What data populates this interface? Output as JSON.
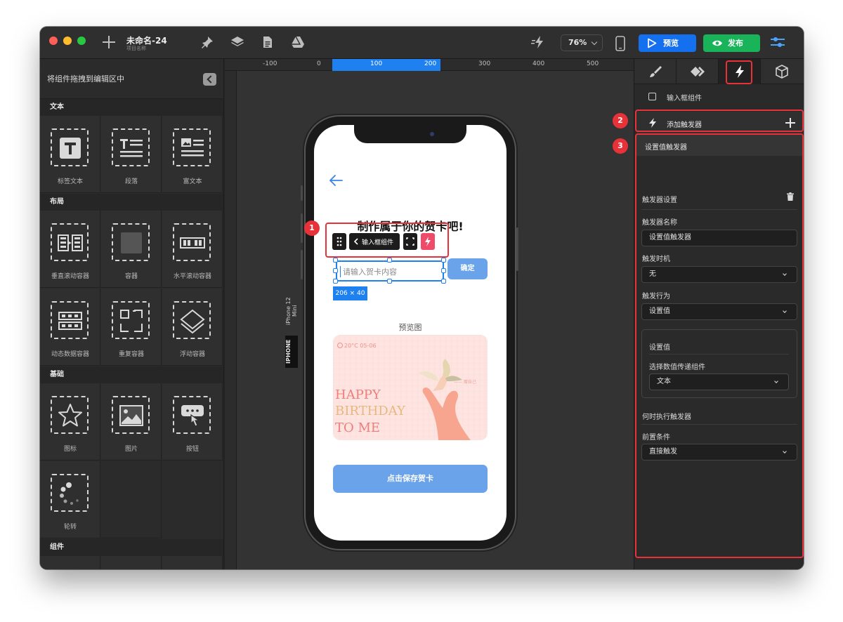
{
  "titlebar": {
    "doc_title": "未命名-24",
    "doc_subtitle": "项目名称",
    "zoom": "76%",
    "preview_label": "预览",
    "publish_label": "发布"
  },
  "left_panel": {
    "title": "将组件拖拽到编辑区中",
    "sections": [
      {
        "title": "文本",
        "items": [
          "标签文本",
          "段落",
          "富文本"
        ]
      },
      {
        "title": "布局",
        "items": [
          "垂直滚动容器",
          "容器",
          "水平滚动容器",
          "动态数据容器",
          "重复容器",
          "浮动容器"
        ]
      },
      {
        "title": "基础",
        "items": [
          "图标",
          "图片",
          "按钮",
          "轮转"
        ]
      },
      {
        "title": "组件",
        "items": []
      }
    ]
  },
  "canvas": {
    "ruler_ticks": [
      "-100",
      "0",
      "100",
      "200",
      "300",
      "400",
      "500"
    ],
    "device_name": "iPhone 12 Mini",
    "device_tag": "IPHONE",
    "page_title": "制作属于你的贺卡吧!",
    "toolbar_component": "输入框组件",
    "input_placeholder": "请输入贺卡内容",
    "confirm_label": "确定",
    "size_tag": "206 × 40",
    "preview_label": "预览图",
    "card": {
      "weather": "20°C 05-06",
      "signature": "—— 赠自己",
      "line1": "HAPPY",
      "line2": "BIRTHDAY",
      "line3": "TO ME"
    },
    "save_label": "点击保存贺卡"
  },
  "markers": [
    "1",
    "2",
    "3"
  ],
  "right_panel": {
    "component_name": "输入框组件",
    "add_trigger": "添加触发器",
    "trigger_title": "设置值触发器",
    "settings_title": "触发器设置",
    "name_label": "触发器名称",
    "name_value": "设置值触发器",
    "timing_label": "触发时机",
    "timing_value": "无",
    "action_label": "触发行为",
    "action_value": "设置值",
    "inner_title": "设置值",
    "inner_label": "选择数值传递组件",
    "inner_value": "文本",
    "when_title": "何时执行触发器",
    "condition_label": "前置条件",
    "condition_value": "直接触发"
  },
  "colors": {
    "accent": "#1570ef",
    "publish": "#19b35a",
    "annotation": "#e8323a",
    "button_blue": "#6ba3ea"
  }
}
